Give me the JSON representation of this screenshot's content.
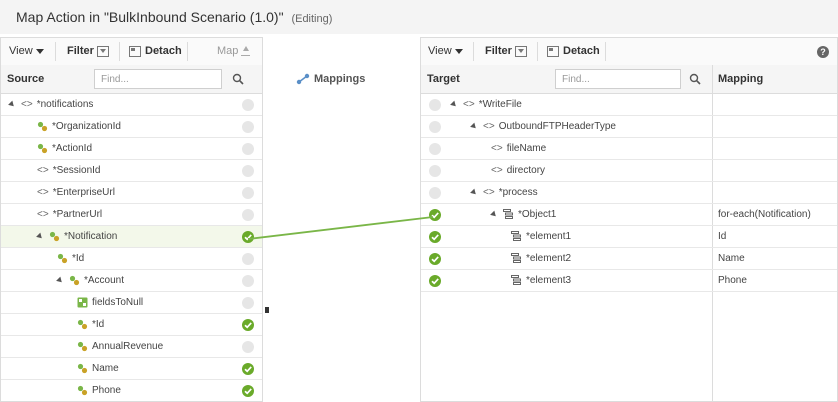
{
  "title": {
    "main": "Map Action in \"BulkInbound Scenario (1.0)\"",
    "status": "(Editing)"
  },
  "left_toolbar": {
    "view": "View",
    "filter": "Filter",
    "detach": "Detach",
    "map": "Map"
  },
  "left_header": {
    "label": "Source",
    "find_placeholder": "Find..."
  },
  "middle": {
    "label": "Mappings"
  },
  "right_toolbar": {
    "view": "View",
    "filter": "Filter",
    "detach": "Detach"
  },
  "right_header": {
    "target": "Target",
    "find_placeholder": "Find...",
    "mapping": "Mapping"
  },
  "source_tree": [
    {
      "label": "*notifications",
      "kind": "element",
      "expander": true,
      "status": "empty"
    },
    {
      "label": "*OrganizationId",
      "kind": "leaf",
      "status": "empty"
    },
    {
      "label": "*ActionId",
      "kind": "leaf",
      "status": "empty"
    },
    {
      "label": "*SessionId",
      "kind": "element",
      "status": "empty"
    },
    {
      "label": "*EnterpriseUrl",
      "kind": "element",
      "status": "empty"
    },
    {
      "label": "*PartnerUrl",
      "kind": "element",
      "status": "empty"
    },
    {
      "label": "*Notification",
      "kind": "leaf",
      "expander": true,
      "status": "ok",
      "selected": true
    },
    {
      "label": "*Id",
      "kind": "leaf",
      "status": "empty"
    },
    {
      "label": "*Account",
      "kind": "leaf",
      "expander": true,
      "status": "empty"
    },
    {
      "label": "fieldsToNull",
      "kind": "leaf-multi",
      "status": "empty"
    },
    {
      "label": "*Id",
      "kind": "leaf",
      "status": "ok"
    },
    {
      "label": "AnnualRevenue",
      "kind": "leaf",
      "status": "empty"
    },
    {
      "label": "Name",
      "kind": "leaf",
      "status": "ok"
    },
    {
      "label": "Phone",
      "kind": "leaf",
      "status": "ok"
    }
  ],
  "target_tree": [
    {
      "label": "*WriteFile",
      "kind": "element",
      "expander": true,
      "status": "empty",
      "mapping": ""
    },
    {
      "label": "OutboundFTPHeaderType",
      "kind": "element",
      "expander": true,
      "status": "empty",
      "mapping": ""
    },
    {
      "label": "fileName",
      "kind": "element",
      "status": "empty",
      "mapping": ""
    },
    {
      "label": "directory",
      "kind": "element",
      "status": "empty",
      "mapping": ""
    },
    {
      "label": "*process",
      "kind": "element",
      "expander": true,
      "status": "empty",
      "mapping": ""
    },
    {
      "label": "*Object1",
      "kind": "repeat",
      "expander": true,
      "status": "ok",
      "mapping": "for-each(Notification)"
    },
    {
      "label": "*element1",
      "kind": "repeat",
      "status": "ok",
      "mapping": "Id"
    },
    {
      "label": "*element2",
      "kind": "repeat",
      "status": "ok",
      "mapping": "Name"
    },
    {
      "label": "*element3",
      "kind": "repeat",
      "status": "ok",
      "mapping": "Phone"
    }
  ],
  "colors": {
    "ok": "#6aaa2a",
    "connector": "#7ab648",
    "selected_row": "#f3f8ea"
  }
}
